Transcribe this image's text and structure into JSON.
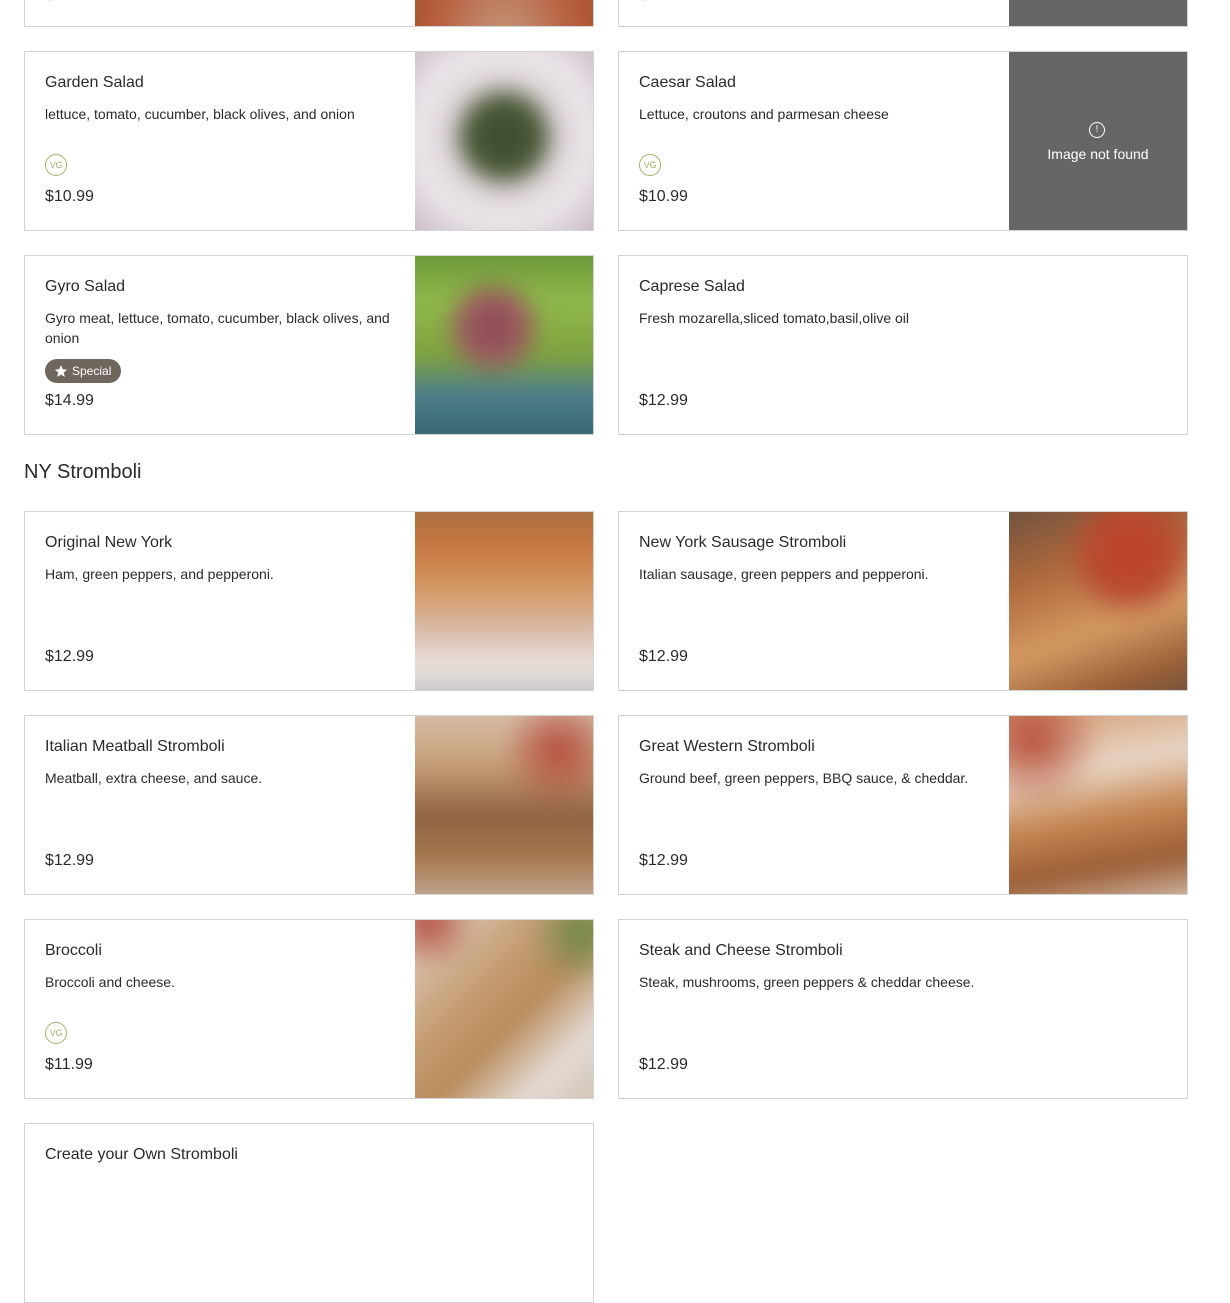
{
  "top_cards": [
    {
      "price": "$"
    },
    {
      "price": "$"
    }
  ],
  "salads": [
    {
      "title": "Garden Salad",
      "desc": "lettuce, tomato, cucumber, black olives, and onion",
      "badge": "VG",
      "price": "$10.99",
      "image": "photo"
    },
    {
      "title": "Caesar Salad",
      "desc": "Lettuce, croutons and parmesan cheese",
      "badge": "VG",
      "price": "$10.99",
      "image_missing_text": "Image not found",
      "image_missing_icon": "!"
    },
    {
      "title": "Gyro Salad",
      "desc": "Gyro meat, lettuce, tomato, cucumber, black olives, and onion",
      "special_label": "Special",
      "price": "$14.99",
      "image": "photo"
    },
    {
      "title": "Caprese Salad",
      "desc": "Fresh mozarella,sliced tomato,basil,olive oil",
      "price": "$12.99"
    }
  ],
  "stromboli_section": {
    "title": "NY Stromboli",
    "items": [
      {
        "title": "Original New York",
        "desc": "Ham, green peppers, and pepperoni.",
        "price": "$12.99",
        "image": "photo"
      },
      {
        "title": "New York Sausage Stromboli",
        "desc": "Italian sausage, green peppers and pepperoni.",
        "price": "$12.99",
        "image": "photo"
      },
      {
        "title": "Italian Meatball Stromboli",
        "desc": "Meatball, extra cheese, and sauce.",
        "price": "$12.99",
        "image": "photo"
      },
      {
        "title": "Great Western Stromboli",
        "desc": "Ground beef, green peppers, BBQ sauce, & cheddar.",
        "price": "$12.99",
        "image": "photo"
      },
      {
        "title": "Broccoli",
        "desc": "Broccoli and cheese.",
        "badge": "VG",
        "price": "$11.99",
        "image": "photo"
      },
      {
        "title": "Steak and Cheese Stromboli",
        "desc": "Steak, mushrooms, green peppers & cheddar cheese.",
        "price": "$12.99"
      },
      {
        "title": "Create your Own Stromboli"
      }
    ]
  },
  "colors": {
    "vegetarian_badge": "#9ab56a",
    "special_badge": "#6f665e",
    "missing_image_bg": "#666666",
    "card_border": "#d3d3d3"
  },
  "icons": {
    "vegetarian": "vegetarian-badge-icon",
    "special": "star-icon",
    "missing": "alert-circle-icon"
  }
}
